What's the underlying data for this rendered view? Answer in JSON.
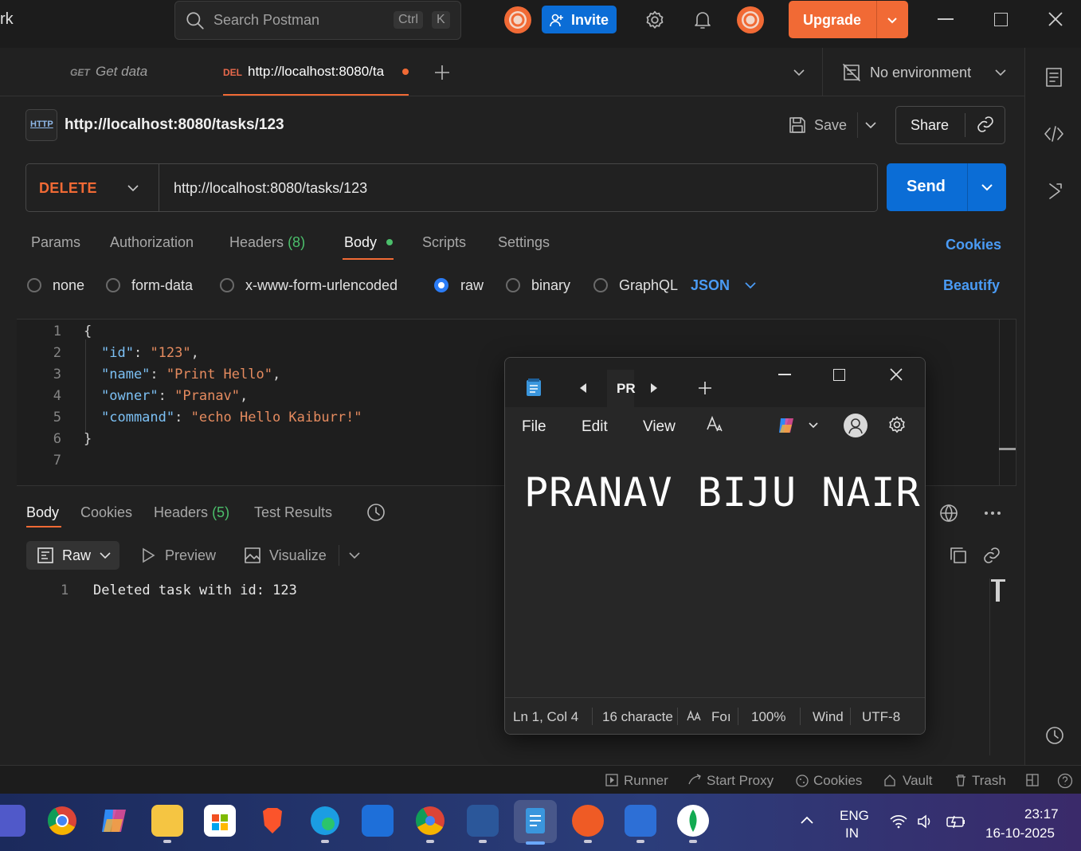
{
  "window": {
    "title_fragment": "rk",
    "search_placeholder": "Search Postman",
    "kbd_ctrl": "Ctrl",
    "kbd_k": "K",
    "invite_label": "Invite",
    "upgrade_label": "Upgrade"
  },
  "tabs": [
    {
      "method": "GET",
      "label": "Get data"
    },
    {
      "method": "DEL",
      "label": "http://localhost:8080/ta"
    }
  ],
  "environment": "No environment",
  "request": {
    "title": "http://localhost:8080/tasks/123",
    "http_badge": "HTTP",
    "save_label": "Save",
    "share_label": "Share",
    "method": "DELETE",
    "url": "http://localhost:8080/tasks/123",
    "send_label": "Send"
  },
  "request_tabs": {
    "params": "Params",
    "authorization": "Authorization",
    "headers": "Headers",
    "headers_count": "(8)",
    "body": "Body",
    "scripts": "Scripts",
    "settings": "Settings",
    "cookies": "Cookies"
  },
  "body_types": {
    "none": "none",
    "form_data": "form-data",
    "urlencoded": "x-www-form-urlencoded",
    "raw": "raw",
    "binary": "binary",
    "graphql": "GraphQL",
    "format": "JSON",
    "beautify": "Beautify"
  },
  "editor": {
    "line_numbers": [
      "1",
      "2",
      "3",
      "4",
      "5",
      "6",
      "7"
    ],
    "open_brace": "{",
    "close_brace": "}",
    "rows": [
      {
        "key": "\"id\"",
        "colon": ": ",
        "value": "\"123\"",
        "comma": ","
      },
      {
        "key": "\"name\"",
        "colon": ": ",
        "value": "\"Print Hello\"",
        "comma": ","
      },
      {
        "key": "\"owner\"",
        "colon": ": ",
        "value": "\"Pranav\"",
        "comma": ","
      },
      {
        "key": "\"command\"",
        "colon": ": ",
        "value": "\"echo Hello Kaiburr!\"",
        "comma": ""
      }
    ]
  },
  "response_tabs": {
    "body": "Body",
    "cookies": "Cookies",
    "headers": "Headers",
    "headers_count": "(5)",
    "test_results": "Test Results"
  },
  "response_view": {
    "raw": "Raw",
    "preview": "Preview",
    "visualize": "Visualize"
  },
  "response": {
    "line_number": "1",
    "text": "Deleted task with id: 123"
  },
  "notepad": {
    "tab_label": "PR",
    "menu_file": "File",
    "menu_edit": "Edit",
    "menu_view": "View",
    "content": "PRANAV BIJU NAIR",
    "status_position": "Ln 1, Col 4",
    "status_chars": "16 characte",
    "status_font": "Foı",
    "status_zoom": "100%",
    "status_lineend": "Wind",
    "status_encoding": "UTF-8"
  },
  "bottom_bar": {
    "runner": "Runner",
    "start_proxy": "Start Proxy",
    "cookies": "Cookies",
    "vault": "Vault",
    "trash": "Trash"
  },
  "taskbar": {
    "lang_top": "ENG",
    "lang_bottom": "IN",
    "time": "23:17",
    "date": "16-10-2025"
  },
  "colors": {
    "accent_orange": "#f16a35",
    "accent_blue": "#0b6dd6",
    "link_blue": "#4a9bf5",
    "count_green": "#4bbf6b",
    "json_key": "#7cc0f4",
    "json_string": "#e58b5f"
  }
}
